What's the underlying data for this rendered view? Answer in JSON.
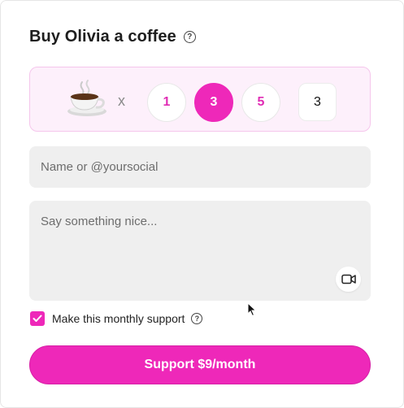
{
  "header": {
    "title": "Buy Olivia a coffee",
    "help_icon": "question-circle-icon"
  },
  "quantity": {
    "item_icon": "coffee-cup-icon",
    "multiplier": "x",
    "options": [
      "1",
      "3",
      "5"
    ],
    "selected": "3",
    "custom_value": "3"
  },
  "form": {
    "name_placeholder": "Name or @yoursocial",
    "message_placeholder": "Say something nice...",
    "video_icon": "video-camera-icon"
  },
  "monthly": {
    "label": "Make this monthly support",
    "checked": true,
    "help_icon": "question-circle-icon"
  },
  "cta": {
    "label": "Support $9/month"
  },
  "colors": {
    "accent": "#ee28b9",
    "panel_bg": "#fdf0fb",
    "field_bg": "#efefef"
  }
}
